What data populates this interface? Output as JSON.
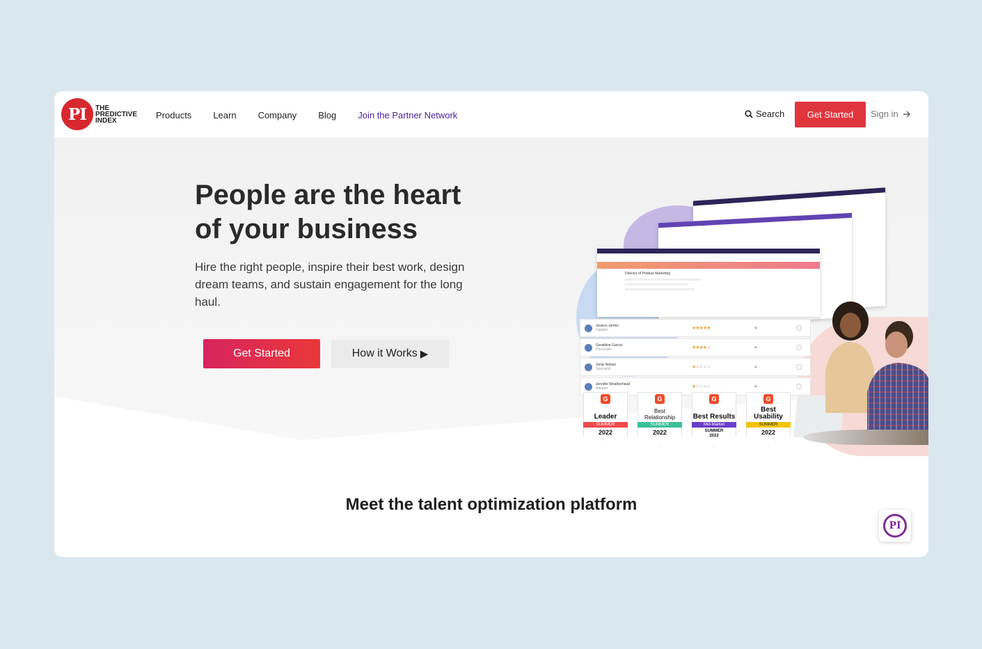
{
  "header": {
    "logo_mark": "PI",
    "logo_lines": [
      "THE",
      "PREDICTIVE",
      "INDEX"
    ],
    "nav": [
      "Products",
      "Learn",
      "Company",
      "Blog",
      "Join the Partner Network"
    ],
    "search_label": "Search",
    "cta_label": "Get Started",
    "signin_label": "Sign in"
  },
  "hero": {
    "headline": "People are the heart of your business",
    "subtitle": "Hire the right people, inspire their best work, design dream teams, and sustain engagement for the long haul.",
    "primary_cta": "Get Started",
    "secondary_cta": "How it Works",
    "secondary_icon": "play-icon"
  },
  "illustration": {
    "job_title": "Director of Product Marketing",
    "candidates": [
      {
        "name": "Jessica James",
        "role": "Captain",
        "stars": 5
      },
      {
        "name": "Geraldine Garcia",
        "role": "Persuader",
        "stars": 4
      },
      {
        "name": "Jordy Nelson",
        "role": "Specialist",
        "stars": 1.5
      },
      {
        "name": "Jennifer Weatherhead",
        "role": "Adapter",
        "stars": 1
      }
    ],
    "badges": [
      {
        "title": "Leader",
        "ribbon": "SUMMER",
        "ribbon_color": "#ef4a4a",
        "year": "2022"
      },
      {
        "title": "Best Relationship",
        "ribbon": "SUMMER",
        "ribbon_color": "#3dbf9a",
        "year": "2022"
      },
      {
        "title": "Best Results",
        "ribbon": "Mid-Market",
        "ribbon_color": "#6a3ec7",
        "year": "SUMMER 2022"
      },
      {
        "title": "Best Usability",
        "ribbon": "SUMMER",
        "ribbon_color": "#f2c400",
        "year": "2022"
      }
    ]
  },
  "section": {
    "title_pre": "Meet the ",
    "title_bold": "talent optimization",
    "title_post": " platform"
  },
  "chat": {
    "label": "PI"
  },
  "colors": {
    "brand_red": "#e0363e",
    "partner_purple": "#4a1f96",
    "page_bg": "#d9e7ef"
  }
}
